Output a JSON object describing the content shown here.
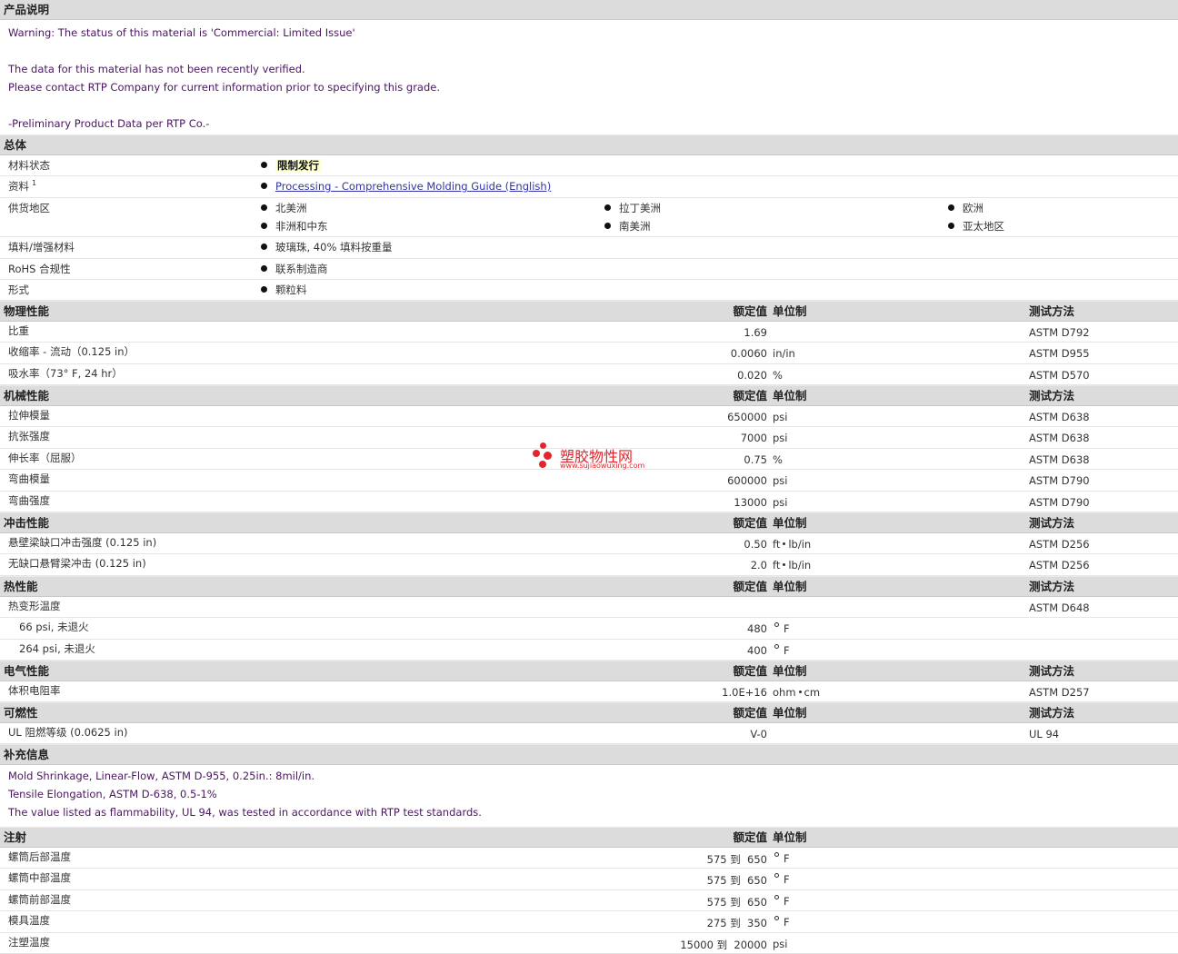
{
  "desc": {
    "title": "产品说明",
    "lines": [
      "Warning: The status of this material is 'Commercial: Limited Issue'",
      "",
      "The data for this material has not been recently verified.",
      "Please contact RTP Company for current information prior to specifying this grade.",
      "",
      "-Preliminary Product Data per RTP Co.-"
    ]
  },
  "general": {
    "title": "总体",
    "status_label": "材料状态",
    "status_value": "限制发行",
    "resources_label": "资料",
    "resources_sup": "1",
    "resources_link": "Processing - Comprehensive Molding Guide (English)",
    "region_label": "供货地区",
    "regions": [
      "北美洲",
      "拉丁美洲",
      "欧洲",
      "非洲和中东",
      "南美洲",
      "亚太地区"
    ],
    "filler_label": "填料/增强材料",
    "filler_value": "玻璃珠, 40% 填料按重量",
    "rohs_label": "RoHS 合规性",
    "rohs_value": "联系制造商",
    "form_label": "形式",
    "form_value": "颗粒料"
  },
  "col_headers": {
    "value": "额定值",
    "unit": "单位制",
    "test": "测试方法"
  },
  "physical": {
    "title": "物理性能",
    "rows": [
      {
        "label": "比重",
        "value": "1.69",
        "unit": "",
        "test": "ASTM D792"
      },
      {
        "label": "收缩率  - 流动（0.125 in）",
        "value": "0.0060",
        "unit": "in/in",
        "test": "ASTM D955"
      },
      {
        "label": "吸水率（73° F, 24 hr）",
        "value": "0.020",
        "unit": "%",
        "test": "ASTM D570"
      }
    ]
  },
  "mechanical": {
    "title": "机械性能",
    "rows": [
      {
        "label": "拉伸模量",
        "value": "650000",
        "unit": "psi",
        "test": "ASTM D638"
      },
      {
        "label": "抗张强度",
        "value": "7000",
        "unit": "psi",
        "test": "ASTM D638"
      },
      {
        "label": "伸长率（屈服）",
        "value": "0.75",
        "unit": "%",
        "test": "ASTM D638"
      },
      {
        "label": "弯曲模量",
        "value": "600000",
        "unit": "psi",
        "test": "ASTM D790"
      },
      {
        "label": "弯曲强度",
        "value": "13000",
        "unit": "psi",
        "test": "ASTM D790"
      }
    ]
  },
  "impact": {
    "title": "冲击性能",
    "rows": [
      {
        "label": "悬壁梁缺口冲击强度 (0.125 in)",
        "value": "0.50",
        "unit_a": "ft",
        "unit_b": "lb/in",
        "test": "ASTM D256"
      },
      {
        "label": "无缺口悬臂梁冲击  (0.125 in)",
        "value": "2.0",
        "unit_a": "ft",
        "unit_b": "lb/in",
        "test": "ASTM D256"
      }
    ]
  },
  "thermal": {
    "title": "热性能",
    "hdt_label": "热变形温度",
    "hdt_test": "ASTM D648",
    "rows": [
      {
        "label": "66 psi, 未退火",
        "value": "480",
        "unit": "F"
      },
      {
        "label": "264 psi, 未退火",
        "value": "400",
        "unit": "F"
      }
    ]
  },
  "electrical": {
    "title": "电气性能",
    "label": "体积电阻率",
    "value": "1.0E+16",
    "unit_a": "ohm",
    "unit_b": "cm",
    "test": "ASTM D257"
  },
  "flammability": {
    "title": "可燃性",
    "label": "UL 阻燃等级 (0.0625 in)",
    "value": "V-0",
    "test": "UL 94"
  },
  "supplement": {
    "title": "补充信息",
    "lines": [
      "Mold Shrinkage, Linear-Flow, ASTM D-955, 0.25in.: 8mil/in.",
      "Tensile Elongation, ASTM D-638, 0.5-1%",
      "The value listed as flammability, UL 94, was tested in accordance with RTP test standards."
    ]
  },
  "injection": {
    "title": "注射",
    "to_word": "到",
    "rows": [
      {
        "label": "螺筒后部温度",
        "min": "575",
        "max": "650",
        "unit": "F",
        "degree": true
      },
      {
        "label": "螺筒中部温度",
        "min": "575",
        "max": "650",
        "unit": "F",
        "degree": true
      },
      {
        "label": "螺筒前部温度",
        "min": "575",
        "max": "650",
        "unit": "F",
        "degree": true
      },
      {
        "label": "模具温度",
        "min": "275",
        "max": "350",
        "unit": "F",
        "degree": true
      },
      {
        "label": "注塑温度",
        "min": "15000",
        "max": "20000",
        "unit": "psi",
        "degree": false
      }
    ]
  },
  "watermark": {
    "text": "塑胶物性网",
    "url": "www.sujiaowuxing.com",
    "color": "#e4262c"
  }
}
